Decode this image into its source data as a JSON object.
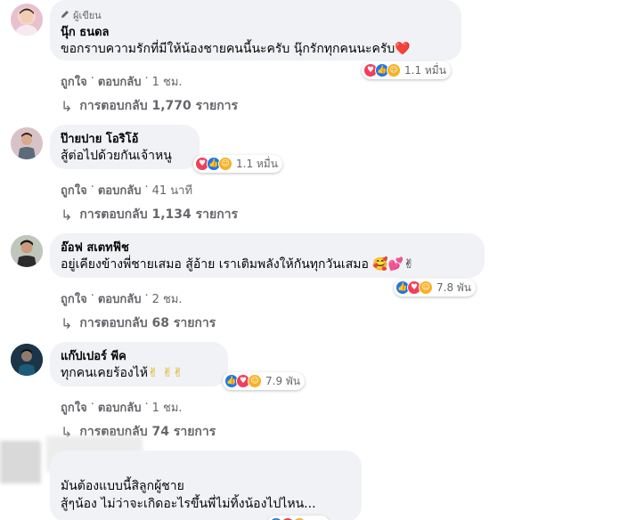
{
  "comments": [
    {
      "badge": "ผู้เขียน",
      "author": "นุ๊ก ธนดล",
      "text": "ขอกราบความรักที่มีให้น้องชายคนนี้นะครับ นุ๊กรักทุกคนนะครับ",
      "emoji_tail": "❤️",
      "reaction_count": "1.1 หมื่น",
      "like": "ถูกใจ",
      "reply": "ตอบกลับ",
      "time": "1 ชม.",
      "replies_label": "การตอบกลับ 1,770 รายการ"
    },
    {
      "author": "ป๊ายปาย โอริโอ้",
      "text": "สู้ต่อไปด้วยกันเจ้าหนู",
      "reaction_count": "1.1 หมื่น",
      "like": "ถูกใจ",
      "reply": "ตอบกลับ",
      "time": "41 นาที",
      "replies_label": "การตอบกลับ 1,134 รายการ"
    },
    {
      "author": "อ๊อฟ สเตทฟ๊ช",
      "text": "อยู่เคียงข้างพี่ชายเสมอ สู้อ้าย เราเติมพลังให้กันทุกวันเสมอ",
      "emoji_tail": "🥰💕✌",
      "reaction_count": "7.8 พัน",
      "like": "ถูกใจ",
      "reply": "ตอบกลับ",
      "time": "2 ชม.",
      "replies_label": "การตอบกลับ 68 รายการ"
    },
    {
      "author": "แก๊ปเปอร์ พีค",
      "text": "ทุกคนเคยร้องไห้",
      "emoji_tail": "✌ ✌✌",
      "reaction_count": "7.9 พัน",
      "like": "ถูกใจ",
      "reply": "ตอบกลับ",
      "time": "1 ชม.",
      "replies_label": "การตอบกลับ 74 รายการ"
    },
    {
      "text_line1": "มันต้องแบบนี้สิลูกผู้ชาย",
      "text_line2": "สู้ๆน้อง ไม่ว่าจะเกิดอะไรขึ้นพี่ไม่ทิ้งน้องไปไหน..."
    }
  ],
  "separator": "·",
  "colors": {
    "bubble": "#f0f2f5",
    "love": "#f33e58",
    "like": "#1877f2",
    "care": "#f7b125",
    "muted": "#65676b"
  }
}
